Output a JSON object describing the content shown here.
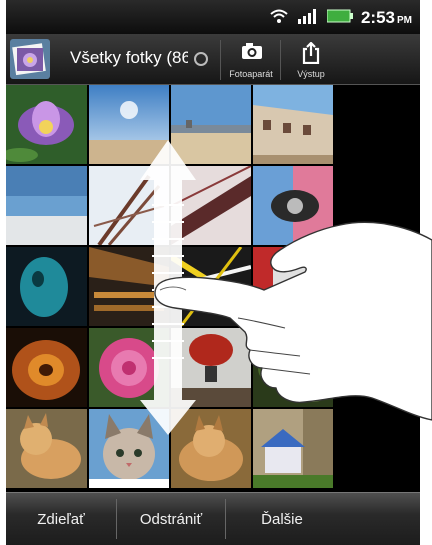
{
  "status_bar": {
    "time": "2:53",
    "ampm": "PM"
  },
  "action_bar": {
    "album_title": "Všetky fotky (86",
    "camera_label": "Fotoaparát",
    "output_label": "Výstup"
  },
  "photos": [
    "water lily",
    "beach",
    "seaside",
    "building",
    "sea",
    "tower",
    "bridge",
    "graffiti",
    "dark portrait",
    "market",
    "lights",
    "red",
    "leaf",
    "rose",
    "lanterns",
    "garden",
    "cat",
    "cat",
    "cat",
    "dog house"
  ],
  "bottom_bar": {
    "share": "Zdieľať",
    "delete": "Odstrániť",
    "more": "Ďalšie"
  },
  "gesture": {
    "type": "vertical scroll",
    "direction": "up-down"
  },
  "colors": {
    "bar_dark": "#1a1a1a",
    "text_light": "#ffffff"
  }
}
